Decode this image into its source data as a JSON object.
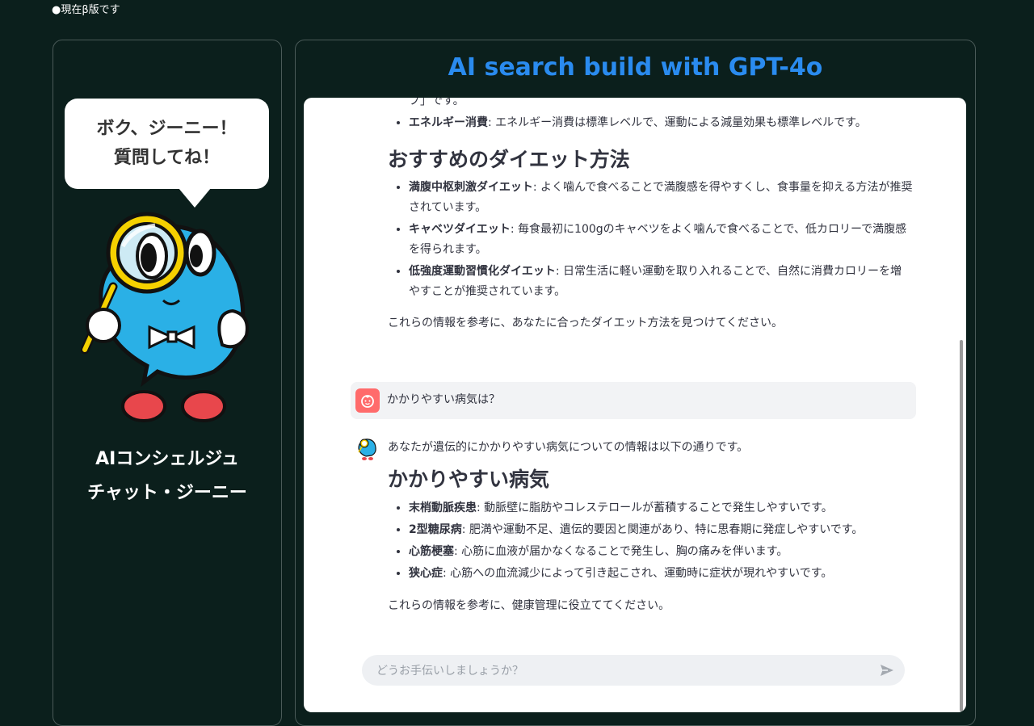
{
  "beta_notice": "●現在β版です",
  "sidebar": {
    "bubble_line1": "ボク、ジーニー！",
    "bubble_line2": "質問してね！",
    "name_line1": "AIコンシェルジュ",
    "name_line2": "チャット・ジーニー"
  },
  "header": {
    "title": "AI search build with GPT-4o"
  },
  "chat": {
    "prev_tail": "プ」です。",
    "prev_item_label": "エネルギー消費",
    "prev_item_text": ": エネルギー消費は標準レベルで、運動による減量効果も標準レベルです。",
    "diet_heading": "おすすめのダイエット方法",
    "diet_items": [
      {
        "label": "満腹中枢刺激ダイエット",
        "text": ": よく噛んで食べることで満腹感を得やすくし、食事量を抑える方法が推奨されています。"
      },
      {
        "label": "キャベツダイエット",
        "text": ": 毎食最初に100gのキャベツをよく噛んで食べることで、低カロリーで満腹感を得られます。"
      },
      {
        "label": "低強度運動習慣化ダイエット",
        "text": ": 日常生活に軽い運動を取り入れることで、自然に消費カロリーを増やすことが推奨されています。"
      }
    ],
    "diet_closing": "これらの情報を参考に、あなたに合ったダイエット方法を見つけてください。",
    "user_message": "かかりやすい病気は？",
    "bot_intro": "あなたが遺伝的にかかりやすい病気についての情報は以下の通りです。",
    "disease_heading": "かかりやすい病気",
    "disease_items": [
      {
        "label": "末梢動脈疾患",
        "text": ": 動脈壁に脂肪やコレステロールが蓄積することで発生しやすいです。"
      },
      {
        "label": "2型糖尿病",
        "text": ": 肥満や運動不足、遺伝的要因と関連があり、特に思春期に発症しやすいです。"
      },
      {
        "label": "心筋梗塞",
        "text": ": 心筋に血液が届かなくなることで発生し、胸の痛みを伴います。"
      },
      {
        "label": "狭心症",
        "text": ": 心筋への血流減少によって引き起こされ、運動時に症状が現れやすいです。"
      }
    ],
    "disease_closing": "これらの情報を参考に、健康管理に役立ててください。"
  },
  "input": {
    "placeholder": "どうお手伝いしましょうか？"
  },
  "icons": {
    "send": "send-icon",
    "user": "user-avatar-icon",
    "bot": "bot-avatar-icon"
  },
  "colors": {
    "accent": "#2a8bef",
    "background": "#0b1f1c",
    "user_avatar": "#ff6b6b",
    "mascot_blue": "#2ab0e6"
  }
}
